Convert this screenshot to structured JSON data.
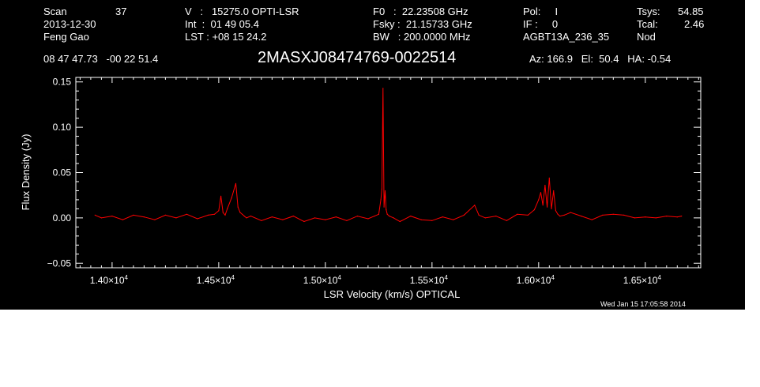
{
  "header": {
    "col1": {
      "scan_label": "Scan",
      "scan_value": "37",
      "date": "2013-12-30",
      "observer": "Feng Gao"
    },
    "col2": {
      "v_line": "V   :   15275.0 OPTI-LSR",
      "int_line": "Int  :  01 49 05.4",
      "lst_line": "LST : +08 15 24.2"
    },
    "col3": {
      "f0_line": "F0   :  22.23508 GHz",
      "fsky_line": "Fsky :  21.15733 GHz",
      "bw_line": "BW   : 200.0000 MHz"
    },
    "col4": {
      "pol_line": "Pol:     I",
      "if_line": "IF :     0",
      "project": "AGBT13A_236_35"
    },
    "col5": {
      "tsys_label": "Tsys:",
      "tsys_value": "54.85",
      "tcal_label": "Tcal:",
      "tcal_value": "2.46",
      "mode": "Nod"
    },
    "coords": "08 47 47.73   -00 22 51.4",
    "source": "2MASXJ08474769-0022514",
    "azelha": "Az: 166.9   El:  50.4   HA: -0.54"
  },
  "timestamp": "Wed Jan 15 17:05:58 2014",
  "colors": {
    "background": "#000000",
    "axes": "#ffffff",
    "spectrum": "#ff0000"
  },
  "chart_data": {
    "type": "line",
    "xlabel": "LSR Velocity (km/s) OPTICAL",
    "ylabel": "Flux Density (Jy)",
    "xlim": [
      13830,
      16760
    ],
    "ylim": [
      -0.055,
      0.155
    ],
    "xticks": [
      {
        "value": 14000,
        "mantissa": "1.40",
        "exp": "4"
      },
      {
        "value": 14500,
        "mantissa": "1.45",
        "exp": "4"
      },
      {
        "value": 15000,
        "mantissa": "1.50",
        "exp": "4"
      },
      {
        "value": 15500,
        "mantissa": "1.55",
        "exp": "4"
      },
      {
        "value": 16000,
        "mantissa": "1.60",
        "exp": "4"
      },
      {
        "value": 16500,
        "mantissa": "1.65",
        "exp": "4"
      }
    ],
    "yticks": [
      {
        "value": -0.05,
        "label": "−0.05"
      },
      {
        "value": 0.0,
        "label": "0.00"
      },
      {
        "value": 0.05,
        "label": "0.05"
      },
      {
        "value": 0.1,
        "label": "0.10"
      },
      {
        "value": 0.15,
        "label": "0.15"
      }
    ],
    "grid": false,
    "legend": "none",
    "series": [
      {
        "color": "#ff0000",
        "x": [
          13920,
          13950,
          14000,
          14050,
          14100,
          14150,
          14200,
          14250,
          14300,
          14350,
          14400,
          14450,
          14480,
          14500,
          14510,
          14520,
          14530,
          14540,
          14560,
          14580,
          14590,
          14600,
          14610,
          14620,
          14630,
          14650,
          14700,
          14750,
          14800,
          14850,
          14900,
          14950,
          15000,
          15050,
          15100,
          15150,
          15200,
          15230,
          15250,
          15260,
          15265,
          15270,
          15275,
          15280,
          15285,
          15290,
          15300,
          15320,
          15350,
          15400,
          15450,
          15500,
          15550,
          15600,
          15650,
          15700,
          15720,
          15750,
          15800,
          15850,
          15900,
          15950,
          15980,
          16000,
          16010,
          16020,
          16030,
          16040,
          16050,
          16060,
          16070,
          16080,
          16090,
          16100,
          16120,
          16150,
          16200,
          16250,
          16300,
          16350,
          16400,
          16450,
          16500,
          16550,
          16600,
          16650,
          16670
        ],
        "values": [
          0.003,
          0.0,
          0.002,
          -0.002,
          0.003,
          0.001,
          -0.002,
          0.003,
          0.0,
          0.004,
          -0.001,
          0.003,
          0.004,
          0.008,
          0.024,
          0.006,
          0.003,
          0.01,
          0.022,
          0.038,
          0.012,
          0.006,
          0.004,
          0.002,
          0.0,
          0.002,
          -0.003,
          0.001,
          -0.002,
          0.002,
          -0.004,
          0.0,
          -0.002,
          0.001,
          -0.003,
          0.002,
          -0.001,
          0.002,
          0.004,
          0.02,
          0.032,
          0.143,
          0.012,
          0.03,
          0.009,
          0.004,
          0.002,
          0.0,
          -0.004,
          0.002,
          -0.002,
          -0.003,
          0.001,
          -0.002,
          0.003,
          0.014,
          0.003,
          0.0,
          0.002,
          -0.003,
          0.004,
          0.003,
          0.009,
          0.02,
          0.028,
          0.014,
          0.036,
          0.012,
          0.044,
          0.01,
          0.03,
          0.008,
          0.004,
          0.002,
          0.003,
          0.006,
          0.002,
          -0.002,
          0.003,
          0.004,
          0.003,
          0.0,
          0.001,
          0.0,
          0.002,
          0.001,
          0.002
        ]
      }
    ]
  }
}
